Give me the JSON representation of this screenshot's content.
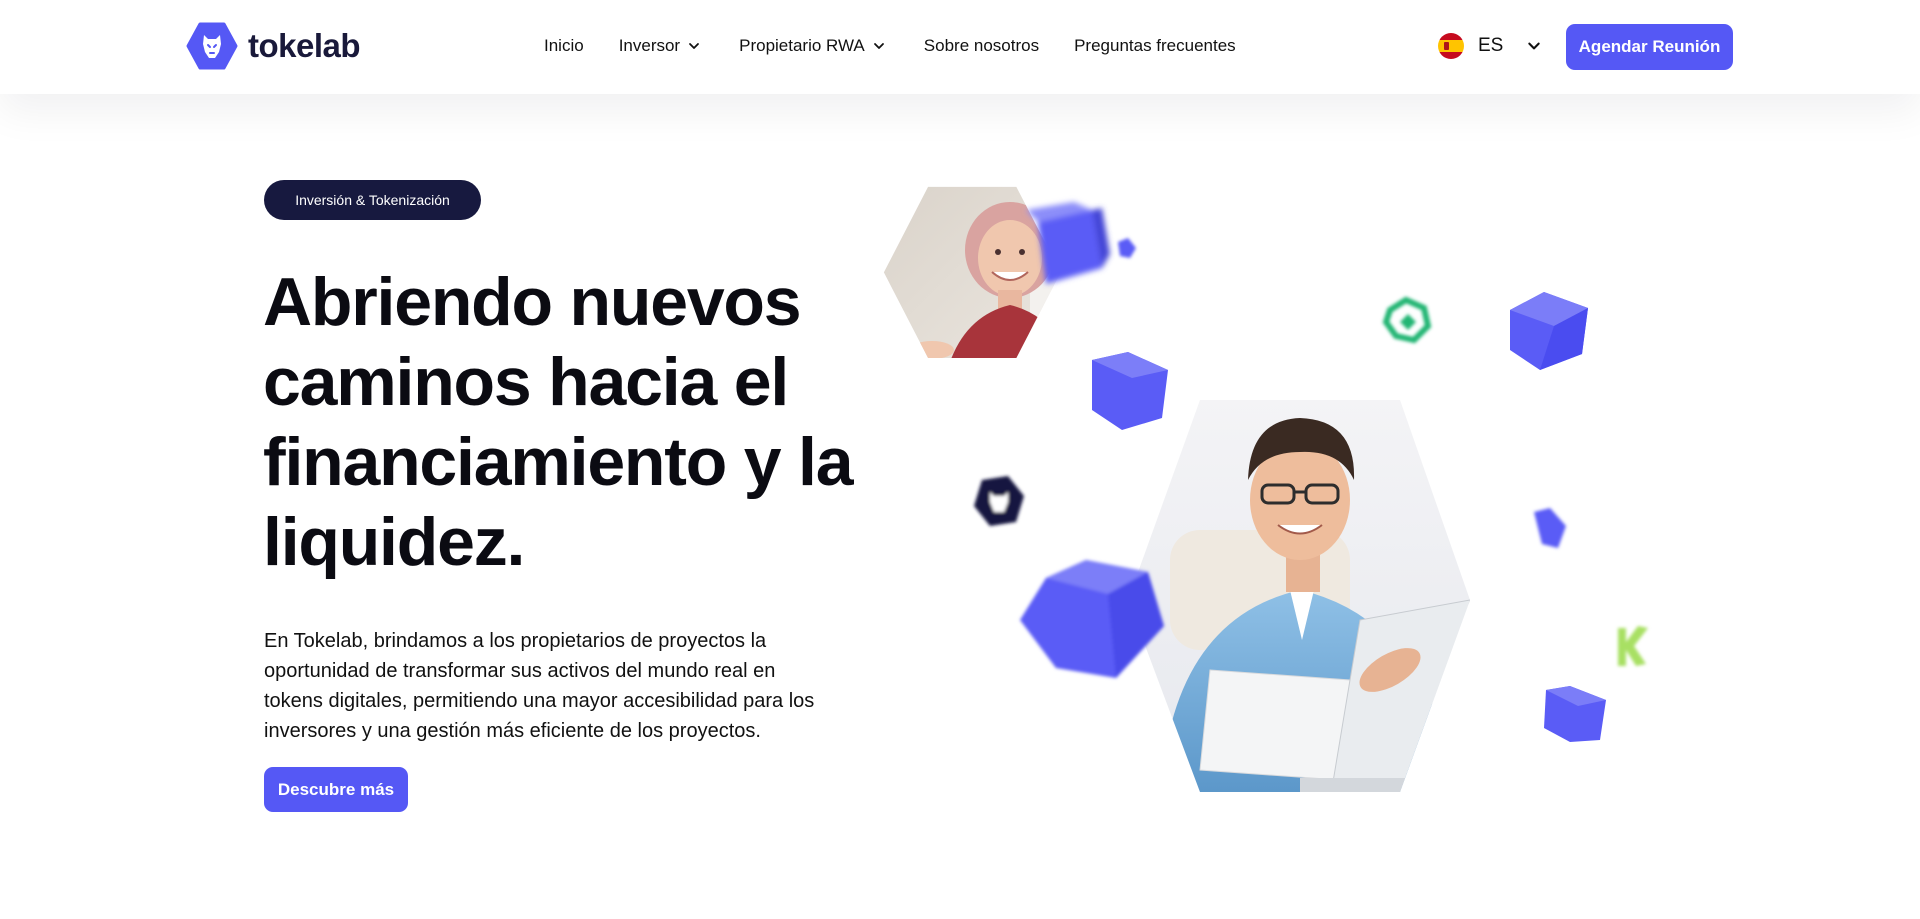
{
  "brand": {
    "name": "tokelab",
    "logo_icon": "tokelab-lion-hex-icon",
    "accent": "#5558f5",
    "dark": "#17193f"
  },
  "nav": {
    "items": [
      {
        "label": "Inicio",
        "has_dropdown": false
      },
      {
        "label": "Inversor",
        "has_dropdown": true
      },
      {
        "label": "Propietario RWA",
        "has_dropdown": true
      },
      {
        "label": "Sobre nosotros",
        "has_dropdown": false
      },
      {
        "label": "Preguntas frecuentes",
        "has_dropdown": false
      }
    ]
  },
  "language": {
    "code": "ES",
    "flag": "spain-flag-icon"
  },
  "header_cta": {
    "label": "Agendar Reunión"
  },
  "hero": {
    "badge": "Inversión & Tokenización",
    "title": "Abriendo nuevos caminos hacia el financiamiento y la liquidez.",
    "description": "En Tokelab, brindamos a los propietarios de proyectos la oportunidad de transformar sus activos del mundo real en tokens digitales, permitiendo una mayor accesibilidad para los inversores y una gestión más eficiente de los proyectos.",
    "cta": "Descubre más"
  },
  "colors": {
    "cube": "#5a5cf6",
    "green_token": "#22b573",
    "lime_token": "#a8e063"
  }
}
